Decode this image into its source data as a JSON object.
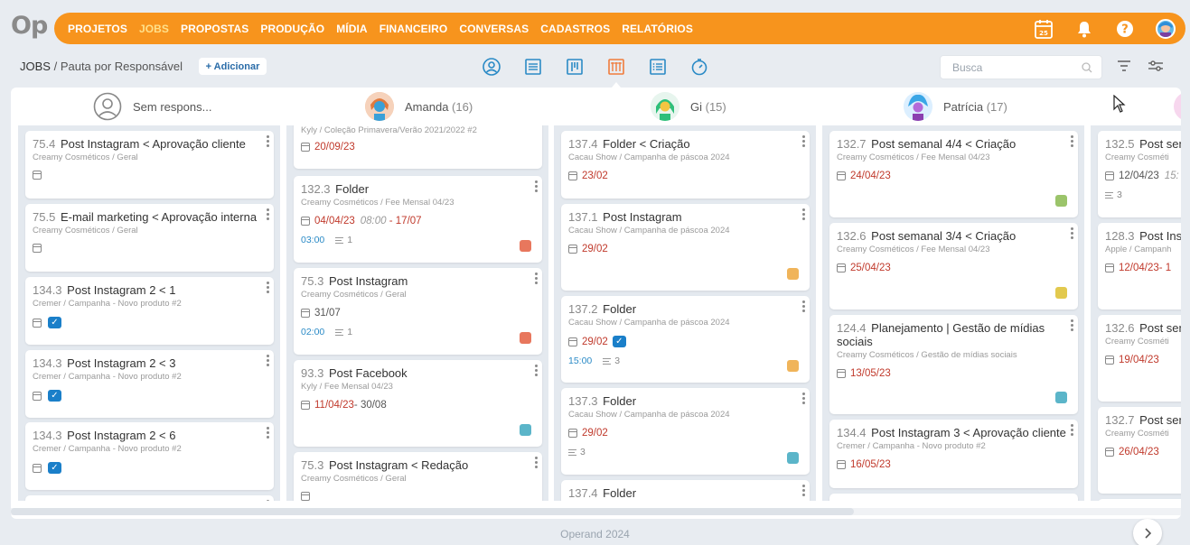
{
  "app": {
    "logo": "Op",
    "footer": "Operand 2024"
  },
  "nav": {
    "items": [
      {
        "label": "PROJETOS",
        "active": false
      },
      {
        "label": "JOBS",
        "active": true
      },
      {
        "label": "PROPOSTAS",
        "active": false
      },
      {
        "label": "PRODUÇÃO",
        "active": false
      },
      {
        "label": "MÍDIA",
        "active": false
      },
      {
        "label": "FINANCEIRO",
        "active": false
      },
      {
        "label": "CONVERSAS",
        "active": false
      },
      {
        "label": "CADASTROS",
        "active": false
      },
      {
        "label": "RELATÓRIOS",
        "active": false
      }
    ],
    "calendar_day": "25",
    "icons": [
      "calendar-icon",
      "bell-icon",
      "help-icon",
      "user-avatar"
    ]
  },
  "subheader": {
    "breadcrumb_root": "JOBS",
    "breadcrumb_sep": " / ",
    "breadcrumb_current": "Pauta por Responsável",
    "add_label": "+ Adicionar",
    "search_placeholder": "Busca",
    "views": [
      "person-icon",
      "list-icon",
      "board-icon",
      "columns-icon",
      "checklist-icon",
      "timer-icon"
    ],
    "active_view": "columns-icon"
  },
  "columns": [
    {
      "name": "Sem respons...",
      "count": ""
    },
    {
      "name": "Amanda",
      "count": "(16)"
    },
    {
      "name": "Gi",
      "count": "(15)"
    },
    {
      "name": "Patrícia",
      "count": "(17)"
    },
    {
      "name": "",
      "count": ""
    }
  ],
  "cards": {
    "col0": [
      {
        "num": "75.4",
        "title": "Post Instagram < Aprovação cliente",
        "sub": "Creamy Cosméticos / Geral"
      },
      {
        "num": "75.5",
        "title": "E-mail marketing < Aprovação interna",
        "sub": "Creamy Cosméticos / Geral"
      },
      {
        "num": "134.3",
        "title": "Post Instagram 2 < 1",
        "sub": "Cremer / Campanha - Novo produto #2"
      },
      {
        "num": "134.3",
        "title": "Post Instagram 2 < 3",
        "sub": "Cremer / Campanha - Novo produto #2"
      },
      {
        "num": "134.3",
        "title": "Post Instagram 2 < 6",
        "sub": "Cremer / Campanha - Novo produto #2"
      }
    ],
    "col1": [
      {
        "num": "",
        "title": "",
        "sub": "Kyly / Coleção Primavera/Verão 2021/2022 #2",
        "date": "20/09/23"
      },
      {
        "num": "132.3",
        "title": "Folder",
        "sub": "Creamy Cosméticos / Fee Mensal 04/23",
        "date": "04/04/23",
        "time_range": "08:00",
        "date_end": "- 17/07",
        "time": "03:00",
        "checklist": "1",
        "tag": "#e8775d"
      },
      {
        "num": "75.3",
        "title": "Post Instagram",
        "sub": "Creamy Cosméticos / Geral",
        "date": "31/07",
        "time": "02:00",
        "checklist": "1",
        "tag": "#e8775d"
      },
      {
        "num": "93.3",
        "title": "Post Facebook",
        "sub": "Kyly / Fee Mensal 04/23",
        "date": "11/04/23",
        "date_end": " - 30/08",
        "tag": "#5bb5c9"
      },
      {
        "num": "75.3",
        "title": "Post Instagram < Redação",
        "sub": "Creamy Cosméticos / Geral"
      }
    ],
    "col2": [
      {
        "num": "137.4",
        "title": "Folder < Criação",
        "sub": "Cacau Show / Campanha de páscoa 2024",
        "date": "23/02"
      },
      {
        "num": "137.1",
        "title": "Post Instagram",
        "sub": "Cacau Show / Campanha de páscoa 2024",
        "date": "29/02",
        "tag": "#f0b45a"
      },
      {
        "num": "137.2",
        "title": "Folder",
        "sub": "Cacau Show / Campanha de páscoa 2024",
        "date": "29/02",
        "time": "15:00",
        "checklist": "3",
        "tag": "#f0b45a"
      },
      {
        "num": "137.3",
        "title": "Folder",
        "sub": "Cacau Show / Campanha de páscoa 2024",
        "date": "29/02",
        "checklist": "3",
        "tag": "#5bb5c9"
      },
      {
        "num": "137.4",
        "title": "Folder",
        "sub": ""
      }
    ],
    "col3": [
      {
        "num": "132.7",
        "title": "Post semanal 4/4 < Criação",
        "sub": "Creamy Cosméticos / Fee Mensal 04/23",
        "date": "24/04/23",
        "tag": "#9bc46a"
      },
      {
        "num": "132.6",
        "title": "Post semanal 3/4 < Criação",
        "sub": "Creamy Cosméticos / Fee Mensal 04/23",
        "date": "25/04/23",
        "tag": "#e2c94e"
      },
      {
        "num": "124.4",
        "title": "Planejamento | Gestão de mídias",
        "title2": "sociais",
        "sub": "Creamy Cosméticos / Gestão de mídias sociais",
        "date": "13/05/23",
        "tag": "#5bb5c9"
      },
      {
        "num": "134.4",
        "title": "Post Instagram 3 < Aprovação cliente",
        "sub": "Cremer / Campanha - Novo produto #2",
        "date": "16/05/23"
      }
    ],
    "col4": [
      {
        "num": "132.5",
        "title": "Post sem",
        "sub": "Creamy Cosméti",
        "date": "12/04/23",
        "time_range": "15:",
        "checklist": "3"
      },
      {
        "num": "128.3",
        "title": "Post Ins",
        "sub": "Apple / Campanh",
        "date": "12/04/23",
        "date_end": " - 1"
      },
      {
        "num": "132.6",
        "title": "Post sem",
        "sub": "Creamy Cosméti",
        "date": "19/04/23"
      },
      {
        "num": "132.7",
        "title": "Post sem",
        "sub": "Creamy Cosméti",
        "date": "26/04/23"
      }
    ]
  }
}
